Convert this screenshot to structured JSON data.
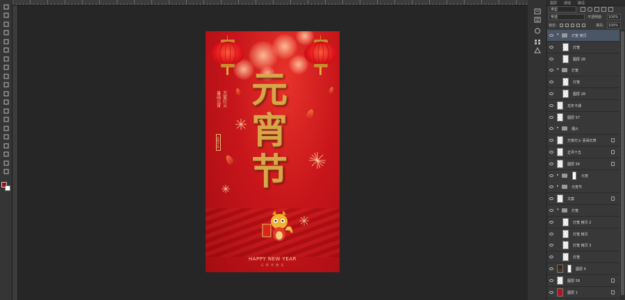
{
  "colors": {
    "workspace": "#262626",
    "panel": "#383838",
    "poster_red": "#c8161b",
    "gold": "#d9a54a",
    "foreground_swatch": "#a01010",
    "background_swatch": "#ffffff",
    "selected_layer": "#4a5566"
  },
  "toolbar": {
    "tools": [
      "move-icon",
      "marquee-icon",
      "lasso-icon",
      "quick-select-icon",
      "crop-icon",
      "eyedropper-icon",
      "healing-icon",
      "brush-icon",
      "stamp-icon",
      "history-brush-icon",
      "eraser-icon",
      "gradient-icon",
      "blur-icon",
      "dodge-icon",
      "pen-icon",
      "text-icon",
      "path-select-icon",
      "shape-icon",
      "hand-icon",
      "zoom-icon"
    ]
  },
  "poster": {
    "title_chars": [
      "元",
      "宵",
      "节"
    ],
    "side_text_1": "万家灯火",
    "side_text_2": "喜闹元宵",
    "stamp_text": "正月十五",
    "footer_main": "HAPPY NEW YEAR",
    "footer_sub": "元 宵 节 快 乐"
  },
  "layers_panel": {
    "tabs": [
      "图层",
      "通道",
      "路径"
    ],
    "filter_label": "类型",
    "blend_mode": "穿透",
    "opacity_label": "不透明度:",
    "opacity_value": "100%",
    "lock_label": "锁定:",
    "fill_label": "填充:",
    "fill_value": "100%",
    "layers": [
      {
        "name": "灯笼 拷贝",
        "kind": "group",
        "indent": 0,
        "selected": true,
        "expanded": true,
        "locked": false
      },
      {
        "name": "灯笼",
        "kind": "layer",
        "indent": 1,
        "selected": false,
        "locked": false
      },
      {
        "name": "图层 28",
        "kind": "layer",
        "indent": 1,
        "selected": false,
        "locked": false
      },
      {
        "name": "灯笼",
        "kind": "group",
        "indent": 0,
        "selected": false,
        "expanded": true,
        "locked": false
      },
      {
        "name": "灯笼",
        "kind": "layer",
        "indent": 1,
        "selected": false,
        "locked": false
      },
      {
        "name": "图层 28",
        "kind": "layer",
        "indent": 1,
        "selected": false,
        "locked": false
      },
      {
        "name": "龙年卡通",
        "kind": "layer",
        "indent": 0,
        "selected": false,
        "locked": false
      },
      {
        "name": "图层 57",
        "kind": "layer",
        "indent": 0,
        "selected": false,
        "locked": false
      },
      {
        "name": "烟火",
        "kind": "group",
        "indent": 0,
        "selected": false,
        "expanded": false,
        "locked": false
      },
      {
        "name": "万家灯火 喜闹元宵",
        "kind": "layer",
        "indent": 0,
        "selected": false,
        "locked": true
      },
      {
        "name": "正月十五",
        "kind": "layer",
        "indent": 0,
        "selected": false,
        "locked": true
      },
      {
        "name": "图层 56",
        "kind": "layer",
        "indent": 0,
        "selected": false,
        "locked": true
      },
      {
        "name": "元宵",
        "kind": "group-masked",
        "indent": 0,
        "selected": false,
        "expanded": false,
        "locked": false
      },
      {
        "name": "元宵节",
        "kind": "group",
        "indent": 0,
        "selected": false,
        "expanded": false,
        "locked": false
      },
      {
        "name": "文案",
        "kind": "layer",
        "indent": 0,
        "selected": false,
        "locked": true
      },
      {
        "name": "灯笼",
        "kind": "group",
        "indent": 0,
        "selected": false,
        "expanded": true,
        "locked": false
      },
      {
        "name": "灯笼 拷贝 2",
        "kind": "layer",
        "indent": 1,
        "selected": false,
        "locked": false
      },
      {
        "name": "灯笼 拷贝",
        "kind": "layer",
        "indent": 1,
        "selected": false,
        "locked": false
      },
      {
        "name": "灯笼 拷贝 3",
        "kind": "layer",
        "indent": 1,
        "selected": false,
        "locked": false
      },
      {
        "name": "灯笼",
        "kind": "layer",
        "indent": 1,
        "selected": false,
        "locked": false
      },
      {
        "name": "图层 4",
        "kind": "image-masked",
        "indent": 0,
        "selected": false,
        "locked": false
      },
      {
        "name": "图层 58",
        "kind": "layer",
        "indent": 0,
        "selected": false,
        "locked": true
      },
      {
        "name": "图层 1",
        "kind": "red",
        "indent": 0,
        "selected": false,
        "locked": true
      }
    ]
  }
}
